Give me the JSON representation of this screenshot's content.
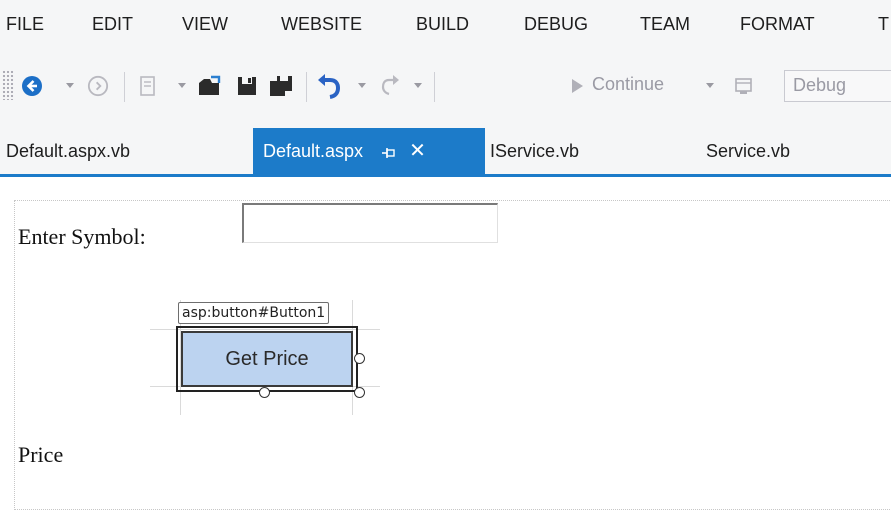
{
  "menu": {
    "items": [
      "FILE",
      "EDIT",
      "VIEW",
      "WEBSITE",
      "BUILD",
      "DEBUG",
      "TEAM",
      "FORMAT",
      "T"
    ]
  },
  "toolbar": {
    "continue_label": "Continue",
    "configuration": "Debug",
    "icons": [
      "back-icon",
      "forward-icon",
      "new-project-icon",
      "open-file-icon",
      "save-icon",
      "save-all-icon",
      "undo-icon",
      "redo-icon",
      "start-icon",
      "attach-process-icon"
    ]
  },
  "tabs": [
    {
      "label": "Default.aspx.vb",
      "active": false
    },
    {
      "label": "Default.aspx",
      "active": true
    },
    {
      "label": "IService.vb",
      "active": false
    },
    {
      "label": "Service.vb",
      "active": false
    }
  ],
  "form": {
    "symbol_label": "Enter Symbol:",
    "symbol_value": "",
    "button_tag": "asp:button#Button1",
    "button_label": "Get Price",
    "price_label": "Price"
  },
  "colors": {
    "accent": "#1c7bc9",
    "button_fill": "#bcd3f0",
    "chrome_bg": "#f5f6f7",
    "back_icon": "#1c6fc7",
    "undo_icon": "#2a63c4"
  }
}
